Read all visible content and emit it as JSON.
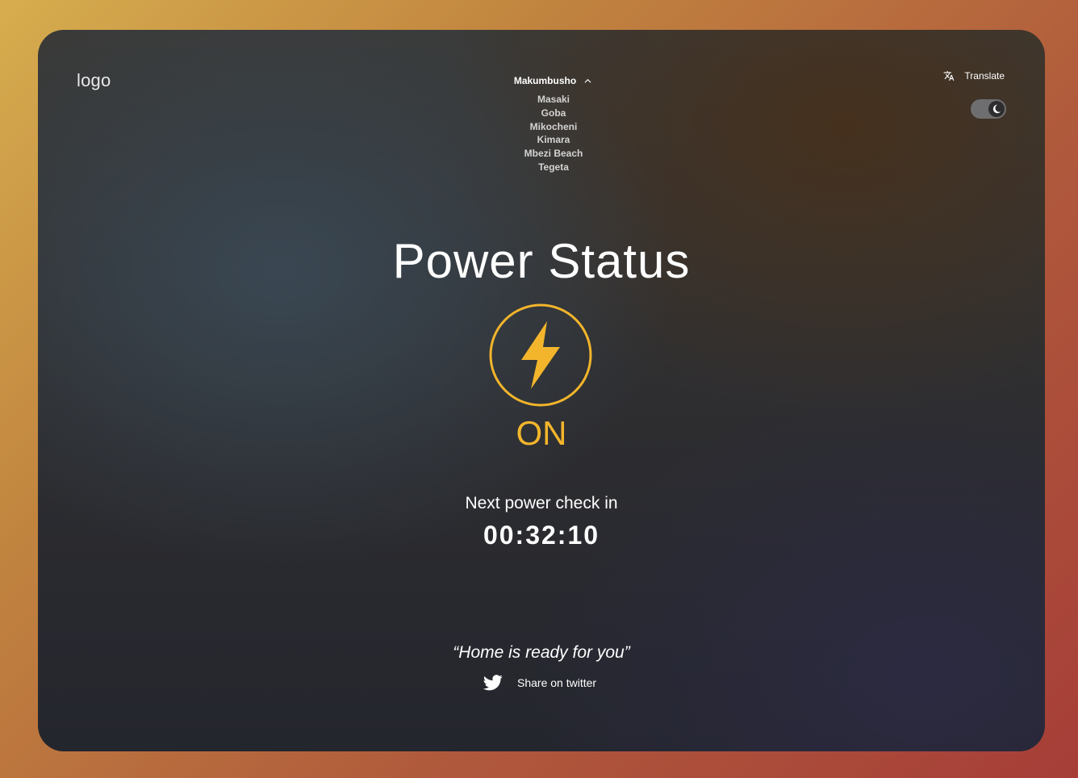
{
  "header": {
    "logo_text": "logo",
    "translate_label": "Translate",
    "translate_icon": "translate-icon",
    "dark_mode_icon": "moon-icon"
  },
  "location": {
    "selected": "Makumbusho",
    "expanded": true,
    "options": [
      "Masaki",
      "Goba",
      "Mikocheni",
      "Kimara",
      "Mbezi Beach",
      "Tegeta"
    ]
  },
  "main": {
    "title": "Power Status",
    "status_icon": "lightning-bolt-icon",
    "status": "ON",
    "next_check_label": "Next power check in",
    "countdown": "00:32:10"
  },
  "footer": {
    "quote": "“Home is ready for you”",
    "share_label": "Share on twitter",
    "share_icon": "twitter-icon"
  },
  "colors": {
    "accent": "#f3b52b",
    "text": "#ffffff",
    "toggle_track": "#6e6e70"
  }
}
